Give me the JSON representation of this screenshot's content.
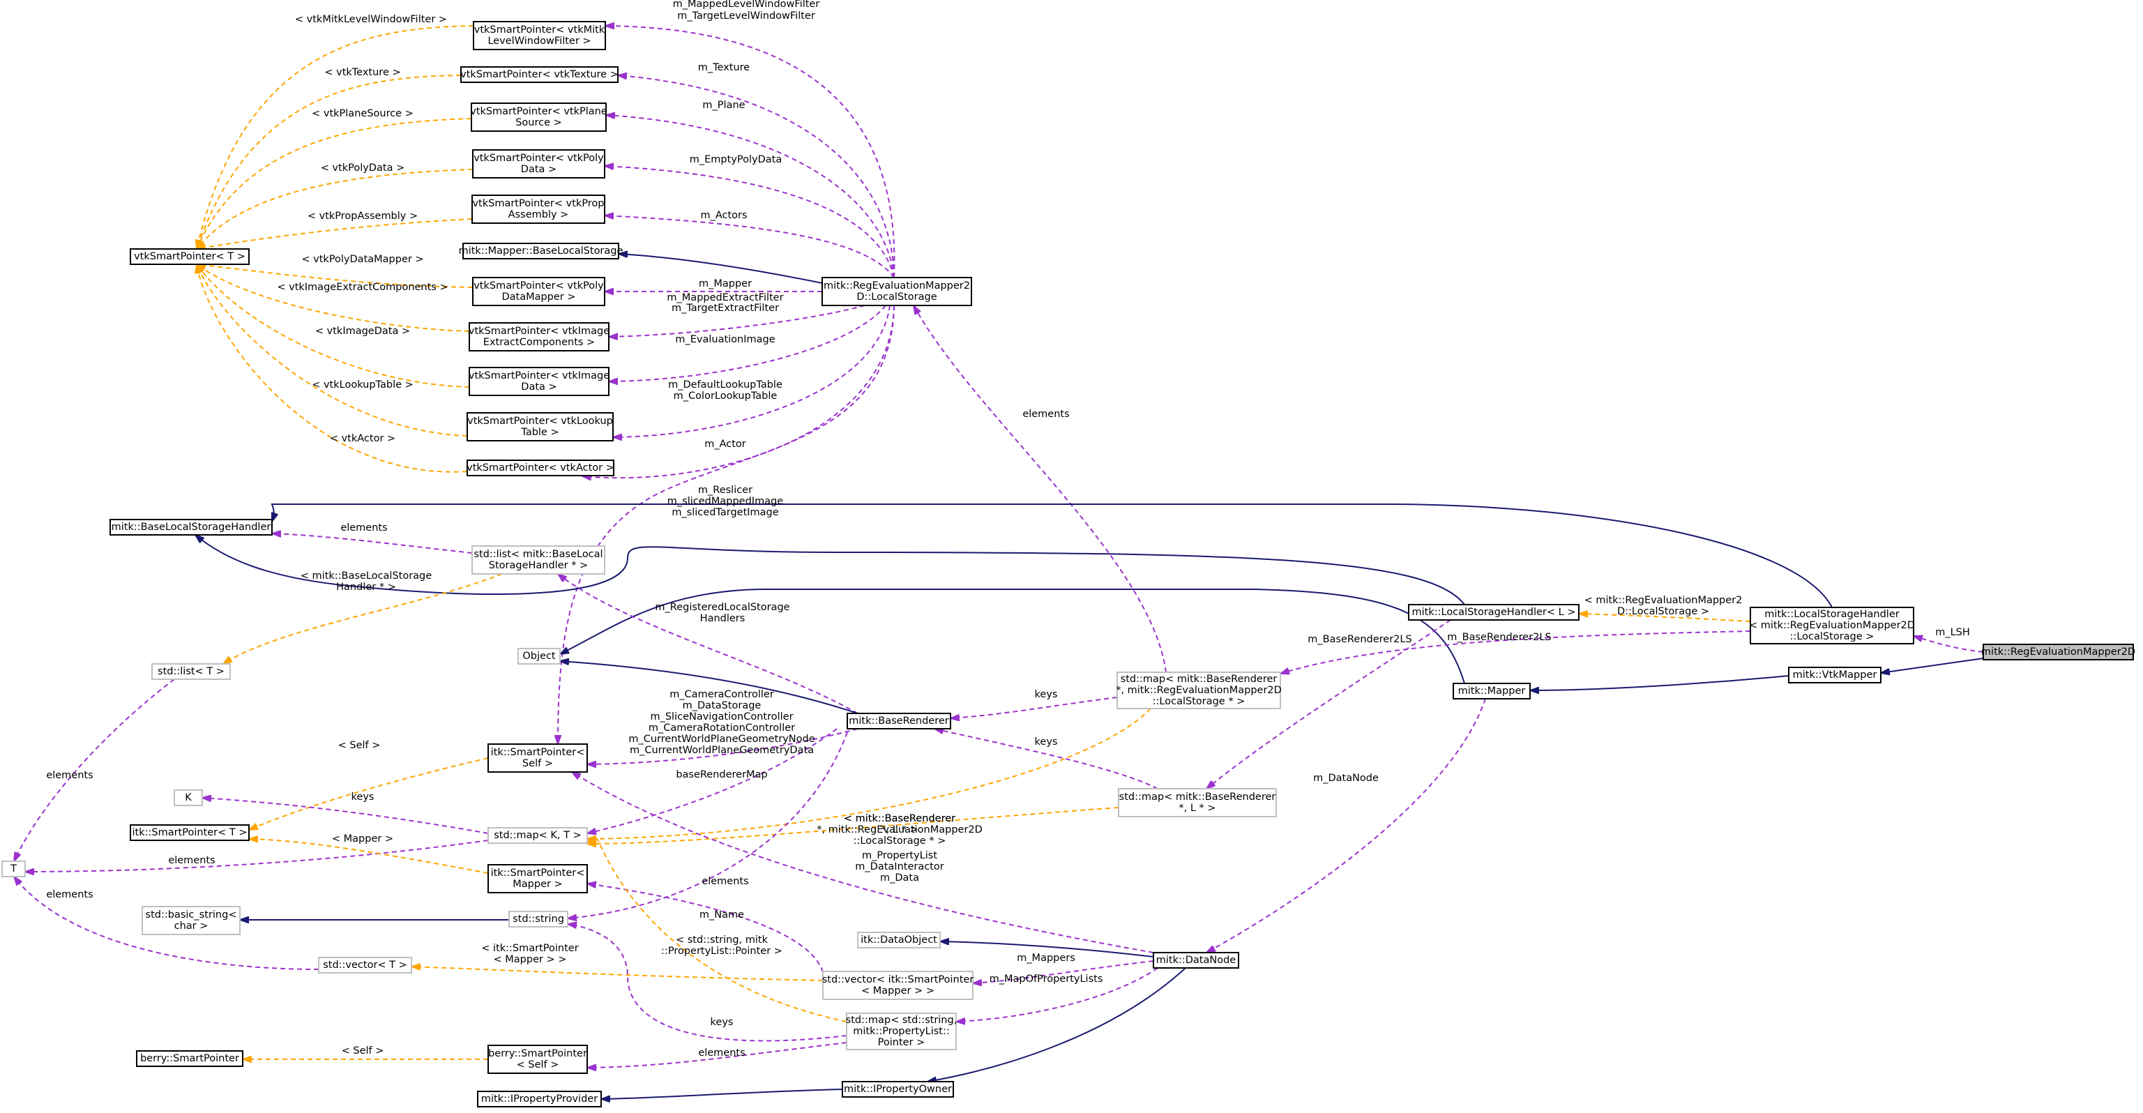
{
  "colors": {
    "inherit": "#191970",
    "usage": "#9a32cd",
    "template": "#ffa500",
    "node_border_solid": "#000000",
    "node_border_light": "#bfbfbf",
    "highlight_fill": "#bfbfbf"
  },
  "nodes": [
    {
      "id": "n_mitk_filter",
      "lines": [
        "vtkSmartPointer< vtkMitk",
        "LevelWindowFilter >"
      ],
      "style": "solid"
    },
    {
      "id": "n_texture",
      "lines": [
        "vtkSmartPointer< vtkTexture >"
      ],
      "style": "solid"
    },
    {
      "id": "n_plane",
      "lines": [
        "vtkSmartPointer< vtkPlane",
        "Source >"
      ],
      "style": "solid"
    },
    {
      "id": "n_polydata",
      "lines": [
        "vtkSmartPointer< vtkPoly",
        "Data >"
      ],
      "style": "solid"
    },
    {
      "id": "n_propassembly",
      "lines": [
        "vtkSmartPointer< vtkProp",
        "Assembly >"
      ],
      "style": "solid"
    },
    {
      "id": "n_vtksp",
      "lines": [
        "vtkSmartPointer< T >"
      ],
      "style": "solid"
    },
    {
      "id": "n_mapper_bls",
      "lines": [
        "mitk::Mapper::BaseLocalStorage"
      ],
      "style": "solid"
    },
    {
      "id": "n_pdm",
      "lines": [
        "vtkSmartPointer< vtkPoly",
        "DataMapper >"
      ],
      "style": "solid"
    },
    {
      "id": "n_localstorage",
      "lines": [
        "mitk::RegEvaluationMapper2",
        "D::LocalStorage"
      ],
      "style": "solid"
    },
    {
      "id": "n_iec",
      "lines": [
        "vtkSmartPointer< vtkImage",
        "ExtractComponents >"
      ],
      "style": "solid"
    },
    {
      "id": "n_imagedata",
      "lines": [
        "vtkSmartPointer< vtkImage",
        "Data >"
      ],
      "style": "solid"
    },
    {
      "id": "n_lookup",
      "lines": [
        "vtkSmartPointer< vtkLookup",
        "Table >"
      ],
      "style": "solid"
    },
    {
      "id": "n_actor",
      "lines": [
        "vtkSmartPointer< vtkActor >"
      ],
      "style": "solid"
    },
    {
      "id": "n_blsh",
      "lines": [
        "mitk::BaseLocalStorageHandler"
      ],
      "style": "solid"
    },
    {
      "id": "n_listbls",
      "lines": [
        "std::list< mitk::BaseLocal",
        "StorageHandler * >"
      ],
      "style": "light"
    },
    {
      "id": "n_lsh_l",
      "lines": [
        "mitk::LocalStorageHandler< L >"
      ],
      "style": "solid"
    },
    {
      "id": "n_lsh_reg",
      "lines": [
        "mitk::LocalStorageHandler",
        "< mitk::RegEvaluationMapper2D",
        "::LocalStorage >"
      ],
      "style": "solid"
    },
    {
      "id": "n_main",
      "lines": [
        "mitk::RegEvaluationMapper2D"
      ],
      "style": "highlight"
    },
    {
      "id": "n_stdlist",
      "lines": [
        "std::list< T >"
      ],
      "style": "light"
    },
    {
      "id": "n_object",
      "lines": [
        "Object"
      ],
      "style": "light"
    },
    {
      "id": "n_mapref",
      "lines": [
        "std::map< mitk::BaseRenderer",
        " *, mitk::RegEvaluationMapper2D",
        "::LocalStorage * >"
      ],
      "style": "light"
    },
    {
      "id": "n_vtkmapper",
      "lines": [
        "mitk::VtkMapper"
      ],
      "style": "solid"
    },
    {
      "id": "n_mapper",
      "lines": [
        "mitk::Mapper"
      ],
      "style": "solid"
    },
    {
      "id": "n_baserenderer",
      "lines": [
        "mitk::BaseRenderer"
      ],
      "style": "solid"
    },
    {
      "id": "n_itksp_self",
      "lines": [
        "itk::SmartPointer<",
        "Self >"
      ],
      "style": "solid"
    },
    {
      "id": "n_K",
      "lines": [
        "K"
      ],
      "style": "light"
    },
    {
      "id": "n_itksp_T",
      "lines": [
        "itk::SmartPointer< T >"
      ],
      "style": "solid"
    },
    {
      "id": "n_mapKT",
      "lines": [
        "std::map< K, T >"
      ],
      "style": "light"
    },
    {
      "id": "n_mapbrL",
      "lines": [
        "std::map< mitk::BaseRenderer",
        " *, L * >"
      ],
      "style": "light"
    },
    {
      "id": "n_T",
      "lines": [
        "T"
      ],
      "style": "light"
    },
    {
      "id": "n_itksp_mapper",
      "lines": [
        "itk::SmartPointer<",
        "Mapper >"
      ],
      "style": "solid"
    },
    {
      "id": "n_basicstring",
      "lines": [
        "std::basic_string<",
        "char >"
      ],
      "style": "light"
    },
    {
      "id": "n_string",
      "lines": [
        "std::string"
      ],
      "style": "light"
    },
    {
      "id": "n_dataobject",
      "lines": [
        "itk::DataObject"
      ],
      "style": "light"
    },
    {
      "id": "n_datanode",
      "lines": [
        "mitk::DataNode"
      ],
      "style": "solid"
    },
    {
      "id": "n_vectorT",
      "lines": [
        "std::vector< T >"
      ],
      "style": "light"
    },
    {
      "id": "n_vecsp",
      "lines": [
        "std::vector< itk::SmartPointer",
        "< Mapper > >"
      ],
      "style": "light"
    },
    {
      "id": "n_mapstrprop",
      "lines": [
        "std::map< std::string,",
        "mitk::PropertyList::",
        "Pointer >"
      ],
      "style": "light"
    },
    {
      "id": "n_berry",
      "lines": [
        "berry::SmartPointer"
      ],
      "style": "solid"
    },
    {
      "id": "n_berryself",
      "lines": [
        "berry::SmartPointer",
        "< Self >"
      ],
      "style": "solid"
    },
    {
      "id": "n_propprovider",
      "lines": [
        "mitk::IPropertyProvider"
      ],
      "style": "solid"
    },
    {
      "id": "n_propowner",
      "lines": [
        "mitk::IPropertyOwner"
      ],
      "style": "solid"
    }
  ],
  "edges": [
    {
      "id": "e_mitkfilter_T",
      "from": "n_mitk_filter",
      "to": "n_vtksp",
      "kind": "template",
      "label": [
        "< vtkMitkLevelWindowFilter >"
      ]
    },
    {
      "id": "e_texture_T",
      "from": "n_texture",
      "to": "n_vtksp",
      "kind": "template",
      "label": [
        "< vtkTexture >"
      ]
    },
    {
      "id": "e_plane_T",
      "from": "n_plane",
      "to": "n_vtksp",
      "kind": "template",
      "label": [
        "< vtkPlaneSource >"
      ]
    },
    {
      "id": "e_polydata_T",
      "from": "n_polydata",
      "to": "n_vtksp",
      "kind": "template",
      "label": [
        "< vtkPolyData >"
      ]
    },
    {
      "id": "e_propassembly_T",
      "from": "n_propassembly",
      "to": "n_vtksp",
      "kind": "template",
      "label": [
        "< vtkPropAssembly >"
      ]
    },
    {
      "id": "e_pdm_T",
      "from": "n_pdm",
      "to": "n_vtksp",
      "kind": "template",
      "label": [
        "< vtkPolyDataMapper >"
      ]
    },
    {
      "id": "e_iec_T",
      "from": "n_iec",
      "to": "n_vtksp",
      "kind": "template",
      "label": [
        "< vtkImageExtractComponents >"
      ]
    },
    {
      "id": "e_imagedata_T",
      "from": "n_imagedata",
      "to": "n_vtksp",
      "kind": "template",
      "label": [
        "< vtkImageData >"
      ]
    },
    {
      "id": "e_lookup_T",
      "from": "n_lookup",
      "to": "n_vtksp",
      "kind": "template",
      "label": [
        "< vtkLookupTable >"
      ]
    },
    {
      "id": "e_actor_T",
      "from": "n_actor",
      "to": "n_vtksp",
      "kind": "template",
      "label": [
        "< vtkActor >"
      ]
    },
    {
      "id": "e_ls_mitkfilter",
      "from": "n_localstorage",
      "to": "n_mitk_filter",
      "kind": "usage",
      "label": [
        "m_MappedLevelWindowFilter",
        "m_TargetLevelWindowFilter"
      ]
    },
    {
      "id": "e_ls_texture",
      "from": "n_localstorage",
      "to": "n_texture",
      "kind": "usage",
      "label": [
        "m_Texture"
      ]
    },
    {
      "id": "e_ls_plane",
      "from": "n_localstorage",
      "to": "n_plane",
      "kind": "usage",
      "label": [
        "m_Plane"
      ]
    },
    {
      "id": "e_ls_polydata",
      "from": "n_localstorage",
      "to": "n_polydata",
      "kind": "usage",
      "label": [
        "m_EmptyPolyData"
      ]
    },
    {
      "id": "e_ls_propassembly",
      "from": "n_localstorage",
      "to": "n_propassembly",
      "kind": "usage",
      "label": [
        "m_Actors"
      ]
    },
    {
      "id": "e_ls_bls",
      "from": "n_localstorage",
      "to": "n_mapper_bls",
      "kind": "inherit",
      "label": []
    },
    {
      "id": "e_ls_pdm",
      "from": "n_localstorage",
      "to": "n_pdm",
      "kind": "usage",
      "label": [
        "m_Mapper"
      ]
    },
    {
      "id": "e_ls_iec",
      "from": "n_localstorage",
      "to": "n_iec",
      "kind": "usage",
      "label": [
        "m_MappedExtractFilter",
        "m_TargetExtractFilter"
      ]
    },
    {
      "id": "e_ls_imagedata",
      "from": "n_localstorage",
      "to": "n_imagedata",
      "kind": "usage",
      "label": [
        "m_EvaluationImage"
      ]
    },
    {
      "id": "e_ls_lookup",
      "from": "n_localstorage",
      "to": "n_lookup",
      "kind": "usage",
      "label": [
        "m_DefaultLookupTable",
        "m_ColorLookupTable"
      ]
    },
    {
      "id": "e_ls_actor",
      "from": "n_localstorage",
      "to": "n_actor",
      "kind": "usage",
      "label": [
        "m_Actor"
      ]
    },
    {
      "id": "e_ls_itkself",
      "from": "n_localstorage",
      "to": "n_itksp_self",
      "kind": "usage",
      "label": [
        "m_Reslicer",
        "m_slicedMappedImage",
        "m_slicedTargetImage"
      ]
    },
    {
      "id": "e_mapref_ls",
      "from": "n_mapref",
      "to": "n_localstorage",
      "kind": "usage",
      "label": [
        "elements"
      ]
    },
    {
      "id": "e_lshreg_blsh",
      "from": "n_lsh_reg",
      "to": "n_blsh",
      "kind": "inherit",
      "label": []
    },
    {
      "id": "e_lshl_blsh",
      "from": "n_lsh_l",
      "to": "n_blsh",
      "kind": "inherit",
      "label": []
    },
    {
      "id": "e_listbls_blsh",
      "from": "n_listbls",
      "to": "n_blsh",
      "kind": "usage",
      "label": [
        "elements"
      ]
    },
    {
      "id": "e_listbls_stdlist",
      "from": "n_listbls",
      "to": "n_stdlist",
      "kind": "template",
      "label": [
        "< mitk::BaseLocalStorage",
        "Handler * >"
      ]
    },
    {
      "id": "e_lshreg_lshl",
      "from": "n_lsh_reg",
      "to": "n_lsh_l",
      "kind": "template",
      "label": [
        "< mitk::RegEvaluationMapper2",
        "D::LocalStorage >"
      ]
    },
    {
      "id": "e_main_lshreg",
      "from": "n_main",
      "to": "n_lsh_reg",
      "kind": "usage",
      "label": [
        "m_LSH"
      ]
    },
    {
      "id": "e_main_vtkmapper",
      "from": "n_main",
      "to": "n_vtkmapper",
      "kind": "inherit",
      "label": []
    },
    {
      "id": "e_vtkmapper_mapper",
      "from": "n_vtkmapper",
      "to": "n_mapper",
      "kind": "inherit",
      "label": []
    },
    {
      "id": "e_mapper_object",
      "from": "n_mapper",
      "to": "n_object",
      "kind": "inherit",
      "label": []
    },
    {
      "id": "e_lshreg_mapref",
      "from": "n_lsh_reg",
      "to": "n_mapref",
      "kind": "usage",
      "label": [
        "m_BaseRenderer2LS"
      ]
    },
    {
      "id": "e_lshl_mapbrl",
      "from": "n_lsh_l",
      "to": "n_mapbrL",
      "kind": "usage",
      "label": [
        "m_BaseRenderer2LS"
      ]
    },
    {
      "id": "e_stdlist_T",
      "from": "n_stdlist",
      "to": "n_T",
      "kind": "usage",
      "label": [
        "elements"
      ]
    },
    {
      "id": "e_br_listbls",
      "from": "n_baserenderer",
      "to": "n_listbls",
      "kind": "usage",
      "label": [
        "m_RegisteredLocalStorage",
        "Handlers"
      ]
    },
    {
      "id": "e_br_object",
      "from": "n_baserenderer",
      "to": "n_object",
      "kind": "inherit",
      "label": []
    },
    {
      "id": "e_mapref_br",
      "from": "n_mapref",
      "to": "n_baserenderer",
      "kind": "usage",
      "label": [
        "keys"
      ]
    },
    {
      "id": "e_mapbrl_br",
      "from": "n_mapbrL",
      "to": "n_baserenderer",
      "kind": "usage",
      "label": [
        "keys"
      ]
    },
    {
      "id": "e_br_itkself",
      "from": "n_baserenderer",
      "to": "n_itksp_self",
      "kind": "usage",
      "label": [
        "m_CameraController",
        "m_DataStorage",
        "m_SliceNavigationController",
        "m_CameraRotationController",
        "m_CurrentWorldPlaneGeometryNode",
        "m_CurrentWorldPlaneGeometryData"
      ]
    },
    {
      "id": "e_br_mapkt",
      "from": "n_baserenderer",
      "to": "n_mapKT",
      "kind": "usage",
      "label": [
        "baseRendererMap"
      ]
    },
    {
      "id": "e_itkself_itkT",
      "from": "n_itksp_self",
      "to": "n_itksp_T",
      "kind": "template",
      "label": [
        "< Self >"
      ]
    },
    {
      "id": "e_mapkt_K",
      "from": "n_mapKT",
      "to": "n_K",
      "kind": "usage",
      "label": [
        "keys"
      ]
    },
    {
      "id": "e_mapkt_T",
      "from": "n_mapKT",
      "to": "n_T",
      "kind": "usage",
      "label": [
        "elements"
      ]
    },
    {
      "id": "e_itkmapper_itkT",
      "from": "n_itksp_mapper",
      "to": "n_itksp_T",
      "kind": "template",
      "label": [
        "< Mapper >"
      ]
    },
    {
      "id": "e_mapref_mapkt",
      "from": "n_mapref",
      "to": "n_mapKT",
      "kind": "template",
      "label": [
        "< mitk::BaseRenderer",
        " *, mitk::RegEvaluationMapper2D",
        "::LocalStorage * >"
      ]
    },
    {
      "id": "e_mapbrl_mapkt",
      "from": "n_mapbrL",
      "to": "n_mapKT",
      "kind": "template",
      "label": [
        "< mitk::BaseRenderer",
        " *, L * >"
      ]
    },
    {
      "id": "e_mapper_datanode",
      "from": "n_mapper",
      "to": "n_datanode",
      "kind": "usage",
      "label": [
        "m_DataNode"
      ]
    },
    {
      "id": "e_datanode_itkself",
      "from": "n_datanode",
      "to": "n_itksp_self",
      "kind": "usage",
      "label": [
        "m_PropertyList",
        "m_DataInteractor",
        "m_Data"
      ]
    },
    {
      "id": "e_vecsp_itkmapper",
      "from": "n_vecsp",
      "to": "n_itksp_mapper",
      "kind": "usage",
      "label": [
        "elements"
      ]
    },
    {
      "id": "e_br_string",
      "from": "n_baserenderer",
      "to": "n_string",
      "kind": "usage",
      "label": [
        "m_Name"
      ]
    },
    {
      "id": "e_string_basic",
      "from": "n_string",
      "to": "n_basicstring",
      "kind": "inherit",
      "label": []
    },
    {
      "id": "e_vectorT_T",
      "from": "n_vectorT",
      "to": "n_T",
      "kind": "usage",
      "label": [
        "elements"
      ]
    },
    {
      "id": "e_vecsp_vectorT",
      "from": "n_vecsp",
      "to": "n_vectorT",
      "kind": "template",
      "label": [
        "< itk::SmartPointer",
        "< Mapper > >"
      ]
    },
    {
      "id": "e_mapstr_mapkt",
      "from": "n_mapstrprop",
      "to": "n_mapKT",
      "kind": "template",
      "label": [
        "< std::string, mitk",
        "::PropertyList::Pointer >"
      ]
    },
    {
      "id": "e_mapstr_string",
      "from": "n_mapstrprop",
      "to": "n_string",
      "kind": "usage",
      "label": [
        "keys"
      ]
    },
    {
      "id": "e_datanode_dataobject",
      "from": "n_datanode",
      "to": "n_dataobject",
      "kind": "inherit",
      "label": []
    },
    {
      "id": "e_datanode_vecsp",
      "from": "n_datanode",
      "to": "n_vecsp",
      "kind": "usage",
      "label": [
        "m_Mappers"
      ]
    },
    {
      "id": "e_datanode_mapstr",
      "from": "n_datanode",
      "to": "n_mapstrprop",
      "kind": "usage",
      "label": [
        "m_MapOfPropertyLists"
      ]
    },
    {
      "id": "e_berryself_berry",
      "from": "n_berryself",
      "to": "n_berry",
      "kind": "template",
      "label": [
        "< Self >"
      ]
    },
    {
      "id": "e_mapstr_berryself",
      "from": "n_mapstrprop",
      "to": "n_berryself",
      "kind": "usage",
      "label": [
        "elements"
      ]
    },
    {
      "id": "e_datanode_propowner",
      "from": "n_datanode",
      "to": "n_propowner",
      "kind": "inherit",
      "label": []
    },
    {
      "id": "e_propowner_provider",
      "from": "n_propowner",
      "to": "n_propprovider",
      "kind": "inherit",
      "label": []
    }
  ]
}
